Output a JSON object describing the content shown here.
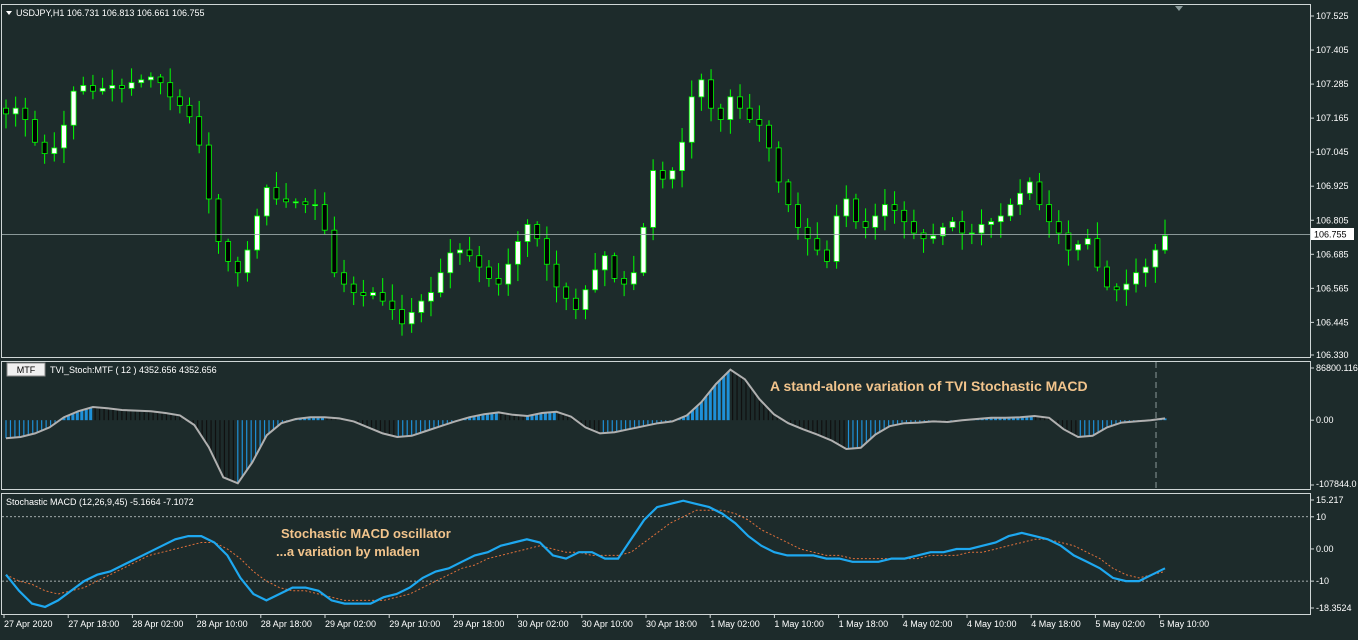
{
  "main": {
    "symbol_header": "USDJPY,H1  106.731 106.813 106.661 106.755",
    "current_price_label": "106.755",
    "current_price": 106.755,
    "price_axis": {
      "min": 106.33,
      "max": 107.525,
      "ticks": [
        "107.525",
        "107.405",
        "107.285",
        "107.165",
        "107.045",
        "106.925",
        "106.805",
        "106.685",
        "106.565",
        "106.445",
        "106.330"
      ]
    },
    "candle_color": "#00ff00",
    "bull_fill": "#ffffff",
    "bear_fill": "#000000"
  },
  "tvi": {
    "mtf_button": "MTF",
    "header": "TVI_Stoch:MTF ( 12 ) 4352.656 4352.656",
    "annotation": "A stand-alone variation of TVI Stochastic MACD",
    "axis_ticks": [
      "86800.116",
      "0.00",
      "-107844.0"
    ],
    "bar_up_color": "#1e90d8",
    "bar_down_color": "#101010",
    "line_color": "#b0b0b0"
  },
  "smacd": {
    "header": "Stochastic MACD (12,26,9,45) -5.1664 -7.1072",
    "annotation_line1": "Stochastic MACD oscillator",
    "annotation_line2": "...a variation by  mladen",
    "axis_ticks": [
      "15.217",
      "10",
      "0.00",
      "-10",
      "-18.3524"
    ],
    "main_color": "#1ea8f0",
    "signal_color": "#e0703a"
  },
  "time_axis": [
    "27 Apr 2020",
    "27 Apr 18:00",
    "28 Apr 02:00",
    "28 Apr 10:00",
    "28 Apr 18:00",
    "29 Apr 02:00",
    "29 Apr 10:00",
    "29 Apr 18:00",
    "30 Apr 02:00",
    "30 Apr 10:00",
    "30 Apr 18:00",
    "1 May 02:00",
    "1 May 10:00",
    "1 May 18:00",
    "4 May 02:00",
    "4 May 10:00",
    "4 May 18:00",
    "5 May 02:00",
    "5 May 10:00"
  ],
  "chart_data": [
    {
      "type": "candlestick",
      "title": "USDJPY,H1",
      "ylim": [
        106.33,
        107.525
      ],
      "series": [
        {
          "name": "USDJPY,H1",
          "close_path": [
            107.18,
            107.2,
            107.16,
            107.08,
            107.04,
            107.06,
            107.14,
            107.26,
            107.28,
            107.26,
            107.27,
            107.28,
            107.27,
            107.29,
            107.3,
            107.31,
            107.29,
            107.24,
            107.21,
            107.17,
            107.07,
            106.88,
            106.73,
            106.66,
            106.62,
            106.7,
            106.82,
            106.92,
            106.88,
            106.87,
            106.87,
            106.86,
            106.86,
            106.77,
            106.62,
            106.58,
            106.55,
            106.54,
            106.55,
            106.52,
            106.49,
            106.44,
            106.48,
            106.52,
            106.55,
            106.62,
            106.69,
            106.7,
            106.68,
            106.64,
            106.6,
            106.58,
            106.65,
            106.73,
            106.79,
            106.74,
            106.65,
            106.57,
            106.53,
            106.49,
            106.56,
            106.63,
            106.68,
            106.6,
            106.58,
            106.62,
            106.78,
            106.98,
            106.95,
            106.98,
            107.08,
            107.24,
            107.3,
            107.2,
            107.16,
            107.24,
            107.2,
            107.16,
            107.14,
            107.06,
            106.94,
            106.86,
            106.78,
            106.74,
            106.7,
            106.66,
            106.82,
            106.88,
            106.8,
            106.78,
            106.82,
            106.86,
            106.84,
            106.8,
            106.76,
            106.74,
            106.75,
            106.78,
            106.8,
            106.76,
            106.76,
            106.79,
            106.8,
            106.82,
            106.86,
            106.9,
            106.94,
            106.86,
            106.8,
            106.76,
            106.7,
            106.72,
            106.74,
            106.64,
            106.57,
            106.56,
            106.58,
            106.62,
            106.64,
            106.7,
            106.75
          ]
        }
      ]
    },
    {
      "type": "bar",
      "title": "TVI_Stoch:MTF ( 12 ) 4352.656 4352.656",
      "ylim": [
        -107844.0,
        86800.116
      ],
      "series": [
        {
          "name": "TVI_Stoch:MTF",
          "values": [
            -30000,
            -28000,
            -22000,
            -12000,
            5000,
            15000,
            22000,
            20000,
            17000,
            16000,
            15000,
            12000,
            8000,
            -8000,
            -45000,
            -95000,
            -105000,
            -70000,
            -25000,
            -5000,
            2000,
            5000,
            5000,
            3000,
            -2000,
            -12000,
            -22000,
            -28000,
            -26000,
            -18000,
            -10000,
            -2000,
            5000,
            10000,
            13000,
            9000,
            7000,
            12000,
            14000,
            6000,
            -12000,
            -22000,
            -20000,
            -15000,
            -10000,
            -5000,
            -2000,
            8000,
            30000,
            60000,
            84000,
            68000,
            35000,
            10000,
            -5000,
            -15000,
            -24000,
            -34000,
            -48000,
            -46000,
            -24000,
            -10000,
            -5000,
            -4000,
            -2000,
            -3000,
            0,
            2000,
            4000,
            4000,
            5000,
            7000,
            4000,
            -15000,
            -28000,
            -26000,
            -12000,
            -4000,
            -2000,
            0,
            3000
          ]
        }
      ]
    },
    {
      "type": "line",
      "title": "Stochastic MACD (12,26,9,45) -5.1664 -7.1072",
      "ylim": [
        -18.3524,
        15.217
      ],
      "series": [
        {
          "name": "Stochastic MACD",
          "values": [
            -8,
            -13,
            -17,
            -18,
            -16,
            -13,
            -10,
            -8,
            -7,
            -5,
            -3,
            -1,
            1,
            3,
            4,
            4,
            2,
            -2,
            -9,
            -14,
            -16,
            -14,
            -12,
            -12,
            -13,
            -16,
            -17,
            -17,
            -17,
            -15,
            -14,
            -12,
            -9,
            -7,
            -6,
            -4,
            -2,
            -1,
            1,
            2,
            3,
            2,
            -2,
            -3,
            -1,
            -1,
            -3,
            -3,
            3,
            9,
            13,
            14,
            15,
            14,
            13,
            11,
            8,
            4,
            1,
            -1,
            -2,
            -2,
            -2,
            -3,
            -3,
            -4,
            -4,
            -4,
            -3,
            -3,
            -2,
            -1,
            -1,
            0,
            0,
            1,
            2,
            4,
            5,
            4,
            3,
            1,
            -2,
            -4,
            -6,
            -9,
            -10,
            -10,
            -8,
            -6
          ]
        },
        {
          "name": "Signal",
          "values": [
            -8,
            -10,
            -11,
            -13,
            -14,
            -13,
            -12,
            -10,
            -8,
            -6,
            -4,
            -2,
            -1,
            0,
            1,
            2,
            2,
            0,
            -3,
            -7,
            -10,
            -12,
            -13,
            -13,
            -14,
            -15,
            -16,
            -16,
            -16,
            -16,
            -15,
            -14,
            -12,
            -10,
            -8,
            -6,
            -5,
            -3,
            -2,
            -1,
            0,
            1,
            0,
            -1,
            -1,
            -2,
            -2,
            -2,
            -1,
            2,
            5,
            8,
            10,
            12,
            12,
            12,
            11,
            9,
            6,
            4,
            2,
            0,
            -1,
            -2,
            -2,
            -3,
            -3,
            -3,
            -3,
            -3,
            -3,
            -2,
            -2,
            -2,
            -1,
            -1,
            0,
            1,
            2,
            3,
            3,
            2,
            1,
            -1,
            -3,
            -6,
            -8,
            -9,
            -8,
            -7
          ]
        }
      ]
    }
  ]
}
